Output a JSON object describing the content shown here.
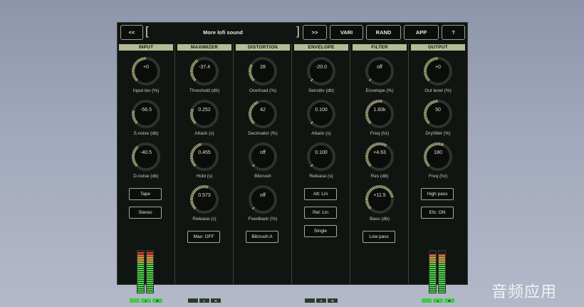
{
  "topbar": {
    "prev_label": "<<",
    "preset_name": "More lofi sound",
    "bracket_left": "[",
    "bracket_right": "]",
    "next_label": ">>",
    "vari_label": "VARI",
    "rand_label": "RAND",
    "app_label": "APP",
    "help_label": "?"
  },
  "colors": {
    "panel_bg": "#101512",
    "header_bg": "#b7bb93",
    "knob_arc": "#c9c98a",
    "meter_green": "#4fd44c",
    "meter_orange": "#e0b04a",
    "meter_red": "#c64a3c"
  },
  "columns": [
    {
      "title": "INPUT",
      "knobs": [
        {
          "value": "+0",
          "label": "Input lev (%)",
          "level": 0.5
        },
        {
          "value": "-56.5",
          "label": "S.noise (db)",
          "level": 0.22
        },
        {
          "value": "-40.5",
          "label": "D.noise (db)",
          "level": 0.35
        }
      ],
      "buttons": [
        "Tape",
        "Stereo"
      ],
      "meter": {
        "levels": [
          0.98,
          0.98
        ],
        "lr": [
          "L",
          "R"
        ]
      }
    },
    {
      "title": "MAXIMIZER",
      "knobs": [
        {
          "value": "-37.4",
          "label": "Threshold (db)",
          "level": 0.38
        },
        {
          "value": "0.252",
          "label": "Attack (s)",
          "level": 0.25
        },
        {
          "value": "0.455",
          "label": "Hold (s)",
          "level": 0.45
        },
        {
          "value": "0.573",
          "label": "Release (s)",
          "level": 0.57
        }
      ],
      "buttons": [
        "Max: OFF"
      ],
      "meter": {
        "levels": [
          0.0,
          0.0
        ],
        "lr": [
          "L",
          "R"
        ]
      }
    },
    {
      "title": "DISTORTION",
      "knobs": [
        {
          "value": "28",
          "label": "Overload (%)",
          "level": 0.28
        },
        {
          "value": "42",
          "label": "Decimator (%)",
          "level": 0.42
        },
        {
          "value": "off",
          "label": "Bitcrush",
          "level": 0.0
        },
        {
          "value": "off",
          "label": "Feedback (%)",
          "level": 0.0
        }
      ],
      "buttons": [
        "Bitcrush A"
      ]
    },
    {
      "title": "ENVELOPE",
      "knobs": [
        {
          "value": "-20.0",
          "label": "Sensitiv (db)",
          "level": 0.02
        },
        {
          "value": "0.100",
          "label": "Attack (s)",
          "level": 0.02
        },
        {
          "value": "0.100",
          "label": "Release (s)",
          "level": 0.02
        }
      ],
      "buttons": [
        "Att: Lin",
        "Rel: Lin",
        "Single"
      ],
      "meter": {
        "levels": [
          0.0,
          0.0
        ],
        "lr": [
          "A",
          "R"
        ]
      }
    },
    {
      "title": "FILTER",
      "knobs": [
        {
          "value": "off",
          "label": "Envelope (%)",
          "level": 0.0
        },
        {
          "value": "1.60k",
          "label": "Freq (hz)",
          "level": 0.55
        },
        {
          "value": "+4.63",
          "label": "Res (db)",
          "level": 0.62
        },
        {
          "value": "+11.5",
          "label": "Bass (db)",
          "level": 0.8
        }
      ],
      "buttons": [
        "Low pass"
      ]
    },
    {
      "title": "OUTPUT",
      "knobs": [
        {
          "value": "+0",
          "label": "Out level (%)",
          "level": 0.5
        },
        {
          "value": "50",
          "label": "Dry/Wet (%)",
          "level": 0.5
        },
        {
          "value": "180",
          "label": "Freq (hz)",
          "level": 0.6
        }
      ],
      "buttons": [
        "High pass",
        "Efx: ON"
      ],
      "meter": {
        "levels": [
          0.92,
          0.92
        ],
        "lr": [
          "L",
          "R"
        ]
      }
    }
  ],
  "watermark": "音频应用"
}
